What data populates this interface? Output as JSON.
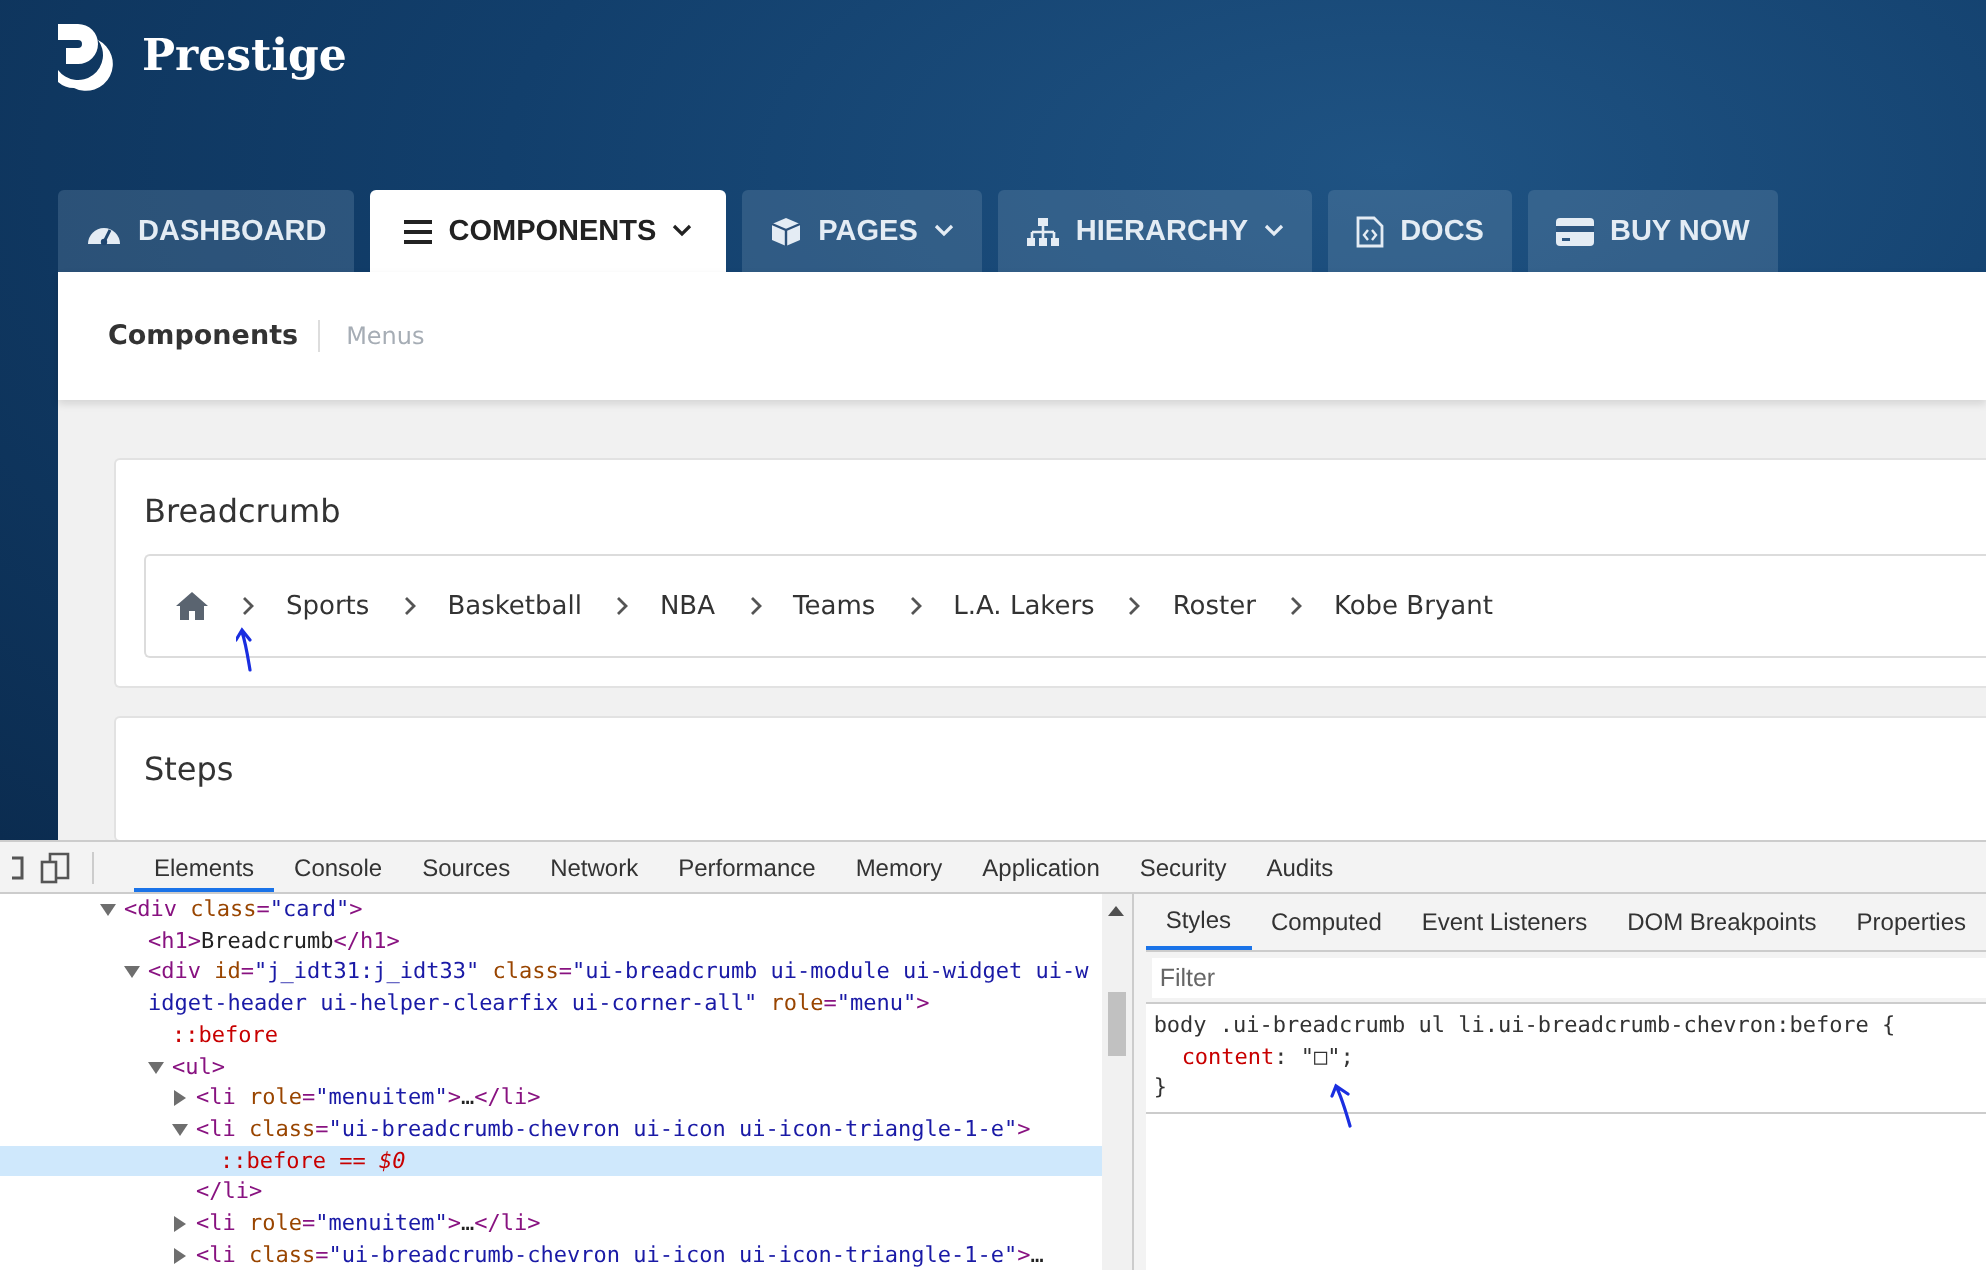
{
  "brand": {
    "name": "Prestige"
  },
  "nav_tabs": [
    {
      "label": "DASHBOARD",
      "dropdown": false,
      "selected": false
    },
    {
      "label": "COMPONENTS",
      "dropdown": true,
      "selected": true
    },
    {
      "label": "PAGES",
      "dropdown": true,
      "selected": false
    },
    {
      "label": "HIERARCHY",
      "dropdown": true,
      "selected": false
    },
    {
      "label": "DOCS",
      "dropdown": false,
      "selected": false
    },
    {
      "label": "BUY NOW",
      "dropdown": false,
      "selected": false
    }
  ],
  "page_header": {
    "title": "Components",
    "subtitle": "Menus"
  },
  "cards": [
    {
      "title": "Breadcrumb",
      "breadcrumb": [
        "Sports",
        "Basketball",
        "NBA",
        "Teams",
        "L.A. Lakers",
        "Roster",
        "Kobe Bryant"
      ]
    },
    {
      "title": "Steps"
    }
  ],
  "devtools": {
    "tabs": [
      {
        "label": "Elements",
        "selected": true
      },
      {
        "label": "Console",
        "selected": false
      },
      {
        "label": "Sources",
        "selected": false
      },
      {
        "label": "Network",
        "selected": false
      },
      {
        "label": "Performance",
        "selected": false
      },
      {
        "label": "Memory",
        "selected": false
      },
      {
        "label": "Application",
        "selected": false
      },
      {
        "label": "Security",
        "selected": false
      },
      {
        "label": "Audits",
        "selected": false
      }
    ],
    "dom_tree": [
      {
        "kind": "element",
        "text": "<div class=\"card\">",
        "expanded": true,
        "selected": false,
        "children": [
          {
            "kind": "element",
            "text": "<h1>Breadcrumb</h1>",
            "selected": false
          },
          {
            "kind": "element",
            "text": "<div id=\"j_idt31:j_idt33\" class=\"ui-breadcrumb ui-module ui-widget ui-widget-header ui-helper-clearfix ui-corner-all\" role=\"menu\">",
            "expanded": true,
            "selected": false,
            "children": [
              {
                "kind": "pseudo",
                "text": "::before",
                "selected": false
              },
              {
                "kind": "element",
                "text": "<ul>",
                "expanded": true,
                "selected": false,
                "children": [
                  {
                    "kind": "element",
                    "text": "<li role=\"menuitem\">…</li>",
                    "expanded": false,
                    "selected": false
                  },
                  {
                    "kind": "element",
                    "text": "<li class=\"ui-breadcrumb-chevron ui-icon ui-icon-triangle-1-e\">",
                    "expanded": true,
                    "selected": false,
                    "closing": "</li>",
                    "children": [
                      {
                        "kind": "pseudo",
                        "text": "::before == *$0*",
                        "selected": true
                      }
                    ]
                  },
                  {
                    "kind": "element",
                    "text": "<li role=\"menuitem\">…</li>",
                    "expanded": false,
                    "selected": false
                  },
                  {
                    "kind": "element",
                    "text": "<li class=\"ui-breadcrumb-chevron ui-icon ui-icon-triangle-1-e\">…",
                    "expanded": false,
                    "selected": false
                  }
                ]
              }
            ]
          }
        ]
      }
    ],
    "styles_tabs": [
      {
        "label": "Styles",
        "selected": true
      },
      {
        "label": "Computed",
        "selected": false
      },
      {
        "label": "Event Listeners",
        "selected": false
      },
      {
        "label": "DOM Breakpoints",
        "selected": false
      },
      {
        "label": "Properties",
        "selected": false
      }
    ],
    "filter": {
      "placeholder": "Filter"
    },
    "css_rule": {
      "selector": "body .ui-breadcrumb ul li.ui-breadcrumb-chevron:before {",
      "declarations": [
        {
          "property": "content",
          "value": ": \"□\";"
        }
      ],
      "close": "}"
    }
  }
}
